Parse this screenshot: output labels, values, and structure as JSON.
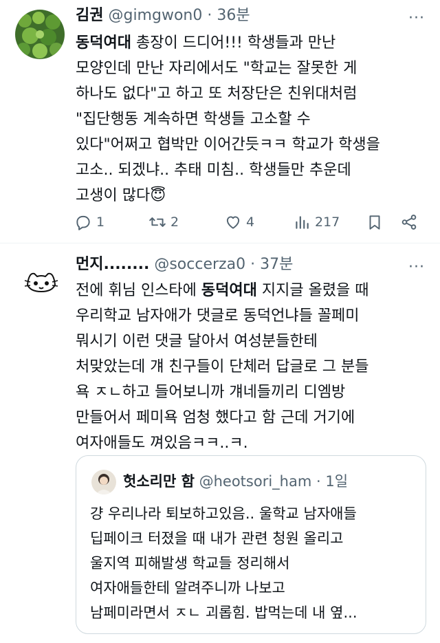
{
  "tweets": [
    {
      "name": "김권",
      "handle": "@gimgwon0",
      "sep": "·",
      "time": "36분",
      "more": "···",
      "lines": [
        {
          "bold": "동덕여대",
          "rest": " 총장이 드디어!!! 학생들과 만난"
        },
        {
          "text": "모양인데 만난 자리에서도 \"학교는 잘못한 게"
        },
        {
          "text": "하나도 없다\"고 하고 또 처장단은 친위대처럼"
        },
        {
          "text": "\"집단행동 계속하면 학생들 고소할 수"
        },
        {
          "text": "있다\"어쩌고 협박만 이어간듯ㅋㅋ 학교가 학생을"
        },
        {
          "text": "고소.. 되겠냐.. 추태 미침.. 학생들만 추운데"
        },
        {
          "text": "고생이 많다",
          "emoji": "😇"
        }
      ],
      "actions": {
        "reply_count": "1",
        "retweet_count": "2",
        "like_count": "4",
        "view_count": "217"
      },
      "icons": [
        "reply-icon",
        "retweet-icon",
        "like-icon",
        "views-icon",
        "bookmark-icon",
        "share-icon"
      ]
    },
    {
      "name": "먼지........",
      "handle": "@soccerza0",
      "sep": "·",
      "time": "37분",
      "more": "···",
      "lines": [
        {
          "pre": "전에 휘님 인스타에 ",
          "bold": "동덕여대",
          "rest": " 지지글 올렸을 때"
        },
        {
          "text": "우리학교 남자애가 댓글로 동덕언냐들 꼴페미"
        },
        {
          "text": "뭐시기 이런 댓글 달아서 여성분들한테"
        },
        {
          "text": "처맞았는데 걔 친구들이 단체러 답글로 그 분들"
        },
        {
          "text": "욕 ㅈㄴ하고 들어보니까 걔네들끼리 디엠방"
        },
        {
          "text": "만들어서 페미욕 엄청 했다고 함 근데 거기에"
        },
        {
          "text": "여자애들도 껴있음ㅋㅋ..ㅋ."
        }
      ],
      "quote": {
        "name": "헛소리만 함",
        "handle": "@heotsori_ham",
        "sep": "·",
        "time": "1일",
        "lines": [
          "걍 우리나라 퇴보하고있음.. 울학교 남자애들",
          "딥페이크 터졌을 때 내가 관련 청원 올리고",
          "울지역 피해발생 학교들 정리해서",
          "여자애들한테 알려주니까 나보고",
          "남페미라면서 ㅈㄴ 괴롭힘. 밥먹는데 내 옆..."
        ]
      }
    }
  ],
  "colors": {
    "text": "#0f1419",
    "muted": "#536471",
    "border": "#cfd9de",
    "divider": "#eff3f4"
  }
}
